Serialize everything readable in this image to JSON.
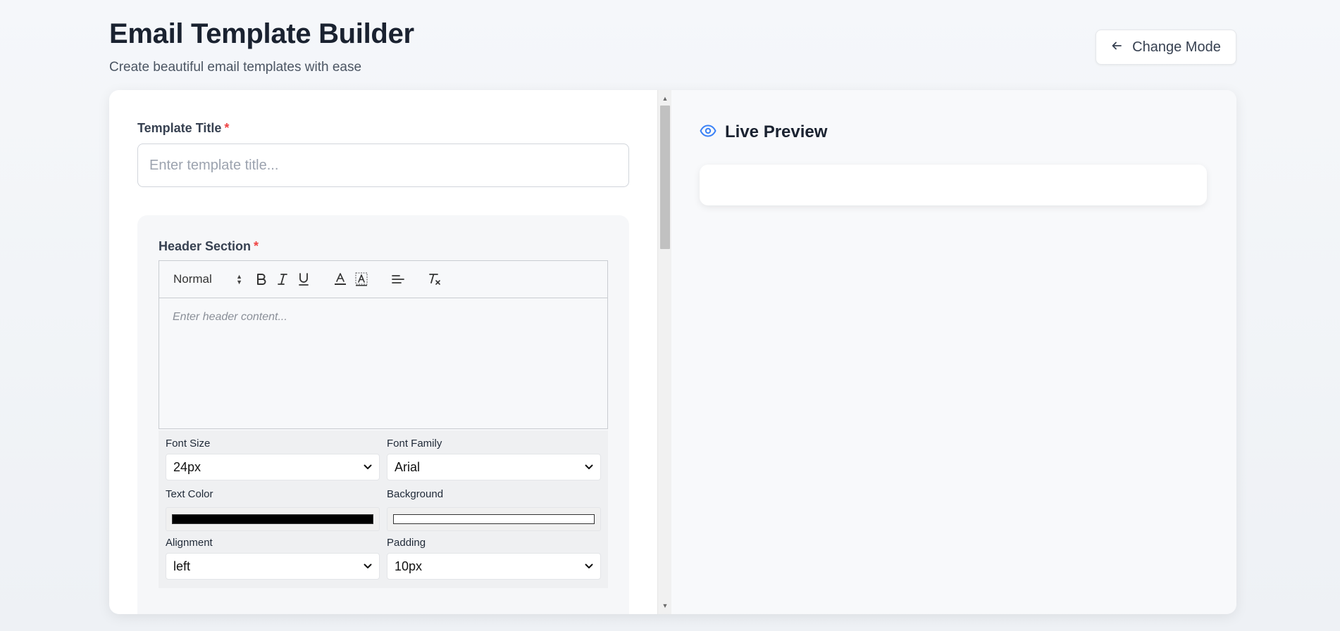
{
  "page": {
    "title": "Email Template Builder",
    "subtitle": "Create beautiful email templates with ease",
    "change_mode_label": "Change Mode"
  },
  "editor": {
    "template_title": {
      "label": "Template Title",
      "required_mark": "*",
      "placeholder": "Enter template title..."
    },
    "header_section": {
      "label": "Header Section",
      "required_mark": "*",
      "toolbar": {
        "format_select": "Normal",
        "buttons": [
          "bold-icon",
          "italic-icon",
          "underline-icon",
          "text-color-icon",
          "background-color-icon",
          "align-left-icon",
          "clear-format-icon"
        ]
      },
      "content_placeholder": "Enter header content...",
      "properties": {
        "font_size": {
          "label": "Font Size",
          "value": "24px"
        },
        "font_family": {
          "label": "Font Family",
          "value": "Arial"
        },
        "text_color": {
          "label": "Text Color",
          "value": "#000000"
        },
        "background": {
          "label": "Background",
          "value": "#ffffff"
        },
        "alignment": {
          "label": "Alignment",
          "value": "left"
        },
        "padding": {
          "label": "Padding",
          "value": "10px"
        }
      }
    }
  },
  "preview": {
    "title": "Live Preview",
    "icon": "eye-icon"
  },
  "colors": {
    "accent": "#3b82f6",
    "required": "#ef4444"
  }
}
